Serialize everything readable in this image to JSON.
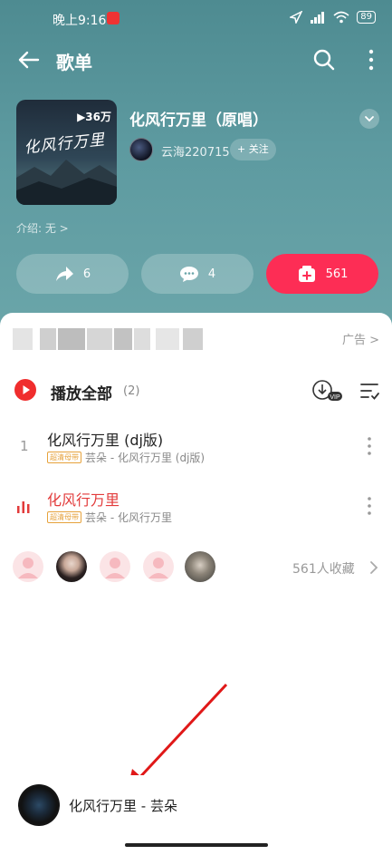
{
  "status_bar": {
    "time": "晚上9:16",
    "battery": "89"
  },
  "nav": {
    "title": "歌单"
  },
  "playlist": {
    "title": "化风行万里（原唱）",
    "play_count": "▶36万",
    "cover_text": "化风行万里",
    "creator": "云海220715",
    "follow_label": "+ 关注",
    "intro": "介绍: 无 >"
  },
  "actions": {
    "share_count": "6",
    "comment_count": "4",
    "collect_count": "561"
  },
  "ad": {
    "label": "广告 >"
  },
  "play_all": {
    "label": "播放全部",
    "count": "(2)"
  },
  "songs": [
    {
      "index": "1",
      "title": "化风行万里 (dj版)",
      "tag": "超清母带",
      "subtitle": "芸朵 - 化风行万里 (dj版)",
      "playing": false
    },
    {
      "index": "",
      "title": "化风行万里",
      "tag": "超清母带",
      "subtitle": "芸朵 - 化风行万里",
      "playing": true
    }
  ],
  "favorites": {
    "count_label": "561人收藏"
  },
  "mini_player": {
    "title": "化风行万里 - 芸朵"
  },
  "colors": {
    "accent": "#fd2d55",
    "hero_bg": "#5d9aa0",
    "playing_red": "#e23b3b"
  }
}
